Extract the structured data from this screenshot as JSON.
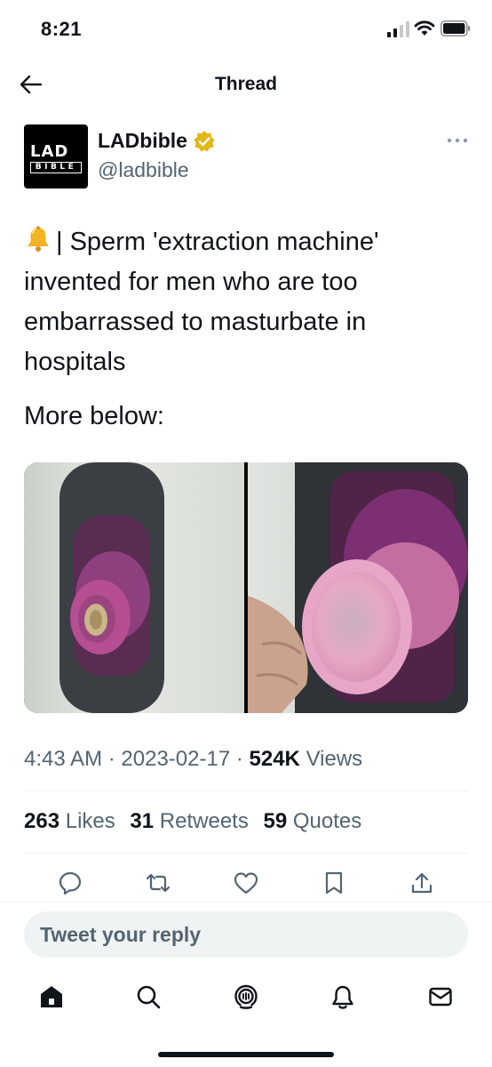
{
  "status_bar": {
    "time": "8:21"
  },
  "header": {
    "title": "Thread"
  },
  "author": {
    "avatar_text_top": "LAD",
    "avatar_text_bottom": "BIBLE",
    "display_name": "LADbible",
    "handle": "@ladbible",
    "verified_color": "#e2b719"
  },
  "tweet": {
    "text_main": "| Sperm 'extraction machine' invented for men who are too embarrassed to masturbate in hospitals",
    "text_more": "More below:",
    "emoji": "bell-icon"
  },
  "meta": {
    "time": "4:43 AM",
    "separator": "·",
    "date": "2023-02-17",
    "views_count": "524K",
    "views_label": "Views"
  },
  "stats": {
    "likes_count": "263",
    "likes_label": "Likes",
    "retweets_count": "31",
    "retweets_label": "Retweets",
    "quotes_count": "59",
    "quotes_label": "Quotes"
  },
  "actions": [
    "reply-icon",
    "retweet-icon",
    "like-icon",
    "bookmark-icon",
    "share-icon"
  ],
  "reply": {
    "placeholder": "Tweet your reply"
  },
  "bottom_nav": [
    "home-icon",
    "search-icon",
    "spaces-icon",
    "notifications-icon",
    "messages-icon"
  ],
  "colors": {
    "text": "#0f1419",
    "secondary": "#536471",
    "divider": "#eff3f4"
  }
}
